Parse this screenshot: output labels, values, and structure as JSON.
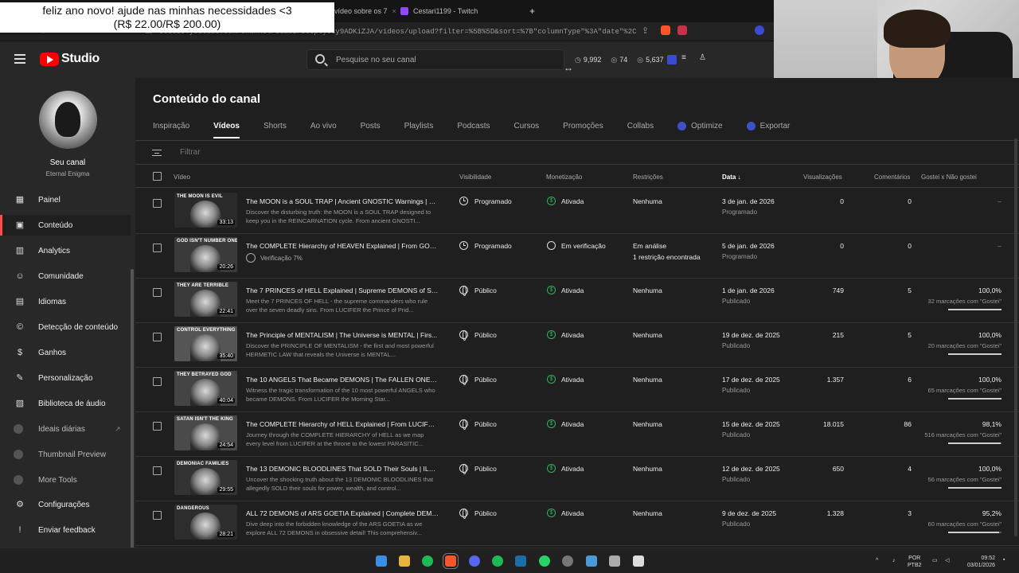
{
  "browser": {
    "tabs": [
      {
        "label": "vídeo sobre os 7"
      },
      {
        "label": "Cestari1199 - Twitch"
      }
    ],
    "new_tab": "+",
    "url": "studio.youtube.com/channel/UCzbIPJ8Cpty6sy9ADKiZJA/videos/upload?filter=%5B%5D&sort=%7B\"columnType\"%3A\"date\"%2C\"sortO..."
  },
  "overlay": {
    "line1": "feliz ano novo! ajude nas minhas necessidades <3",
    "line2": "(R$ 22.00/R$ 200.00)"
  },
  "header": {
    "logo_text": "Studio",
    "search_placeholder": "Pesquise no seu canal",
    "stats": {
      "views": "9,992",
      "likes": "74",
      "subs": "5,637"
    }
  },
  "channel": {
    "name": "Seu canal",
    "handle": "Eternal Enigma"
  },
  "sidebar": {
    "items": [
      {
        "label": "Painel",
        "icon": "dashboard-icon"
      },
      {
        "label": "Conteúdo",
        "icon": "content-icon"
      },
      {
        "label": "Analytics",
        "icon": "analytics-icon"
      },
      {
        "label": "Comunidade",
        "icon": "community-icon"
      },
      {
        "label": "Idiomas",
        "icon": "languages-icon"
      },
      {
        "label": "Detecção de conteúdo",
        "icon": "copyright-icon"
      },
      {
        "label": "Ganhos",
        "icon": "earn-icon"
      },
      {
        "label": "Personalização",
        "icon": "customization-icon"
      },
      {
        "label": "Biblioteca de áudio",
        "icon": "audio-library-icon"
      },
      {
        "label": "Ideais diárias",
        "icon": "extension-icon"
      },
      {
        "label": "Thumbnail Preview",
        "icon": "extension-icon"
      },
      {
        "label": "More Tools",
        "icon": "extension-icon"
      },
      {
        "label": "Configurações",
        "icon": "settings-icon"
      },
      {
        "label": "Enviar feedback",
        "icon": "feedback-icon"
      }
    ]
  },
  "page": {
    "title": "Conteúdo do canal",
    "tabs": [
      "Inspiração",
      "Vídeos",
      "Shorts",
      "Ao vivo",
      "Posts",
      "Playlists",
      "Podcasts",
      "Cursos",
      "Promoções",
      "Collabs",
      "Optimize",
      "Exportar"
    ],
    "filter_placeholder": "Filtrar"
  },
  "table": {
    "headers": {
      "video": "Vídeo",
      "visibility": "Visibilidade",
      "monetization": "Monetização",
      "restrictions": "Restrições",
      "date": "Data",
      "views": "Visualizações",
      "comments": "Comentários",
      "likes": "Gostei x Não gostei"
    },
    "rows": [
      {
        "thumb_text": "THE MOON IS EVIL",
        "duration": "33:13",
        "title": "The MOON is a SOUL TRAP | Ancient GNOSTIC Warnings | RE...",
        "desc": "Discover the disturbing truth: the MOON is a SOUL TRAP designed to keep you in the REINCARNATION cycle. From ancient GNOSTI...",
        "visibility": "Programado",
        "monetization": "Ativada",
        "restrictions": "Nenhuma",
        "restrictions2": "",
        "date": "3 de jan. de 2026",
        "date_status": "Programado",
        "views": "0",
        "comments": "0",
        "likes_pct": "–",
        "likes_sub": "",
        "likes_fraction": 0
      },
      {
        "thumb_text": "GOD ISN'T NUMBER ONE",
        "duration": "20:26",
        "title": "The COMPLETE Hierarchy of HEAVEN Explained | From GOD ...",
        "desc": "",
        "verification": "Verificação 7%",
        "visibility": "Programado",
        "monetization": "Em verificação",
        "restrictions": "Em análise",
        "restrictions2": "1 restrição encontrada",
        "date": "5 de jan. de 2026",
        "date_status": "Programado",
        "views": "0",
        "comments": "0",
        "likes_pct": "–",
        "likes_sub": "",
        "likes_fraction": 0
      },
      {
        "thumb_text": "THEY ARE TERRIBLE",
        "duration": "22:41",
        "title": "The 7 PRINCES of HELL Explained | Supreme DEMONS of Sin...",
        "desc": "Meet the 7 PRINCES OF HELL - the supreme commanders who rule over the seven deadly sins. From LUCIFER the Prince of Prid...",
        "visibility": "Público",
        "monetization": "Ativada",
        "restrictions": "Nenhuma",
        "restrictions2": "",
        "date": "1 de jan. de 2026",
        "date_status": "Publicado",
        "views": "749",
        "comments": "5",
        "likes_pct": "100,0%",
        "likes_sub": "32 marcações com \"Gostei\"",
        "likes_fraction": 1.0
      },
      {
        "thumb_text": "CONTROL EVERYTHING",
        "duration": "35:40",
        "title": "The Principle of MENTALISM | The Universe is MENTAL | Firs...",
        "desc": "Discover the PRINCIPLE OF MENTALISM - the first and most powerful HERMETIC LAW that reveals the Universe is MENTAL...",
        "visibility": "Público",
        "monetization": "Ativada",
        "restrictions": "Nenhuma",
        "restrictions2": "",
        "date": "19 de dez. de 2025",
        "date_status": "Publicado",
        "views": "215",
        "comments": "5",
        "likes_pct": "100,0%",
        "likes_sub": "20 marcações com \"Gostei\"",
        "likes_fraction": 1.0
      },
      {
        "thumb_text": "THEY BETRAYED GOD",
        "duration": "40:04",
        "title": "The 10 ANGELS That Became DEMONS | The FALLEN ONES ...",
        "desc": "Witness the tragic transformation of the 10 most powerful ANGELS who became DEMONS. From LUCIFER the Morning Star...",
        "visibility": "Público",
        "monetization": "Ativada",
        "restrictions": "Nenhuma",
        "restrictions2": "",
        "date": "17 de dez. de 2025",
        "date_status": "Publicado",
        "views": "1.357",
        "comments": "6",
        "likes_pct": "100,0%",
        "likes_sub": "65 marcações com \"Gostei\"",
        "likes_fraction": 1.0
      },
      {
        "thumb_text": "SATAN ISN'T THE KING",
        "duration": "24:54",
        "title": "The COMPLETE Hierarchy of HELL Explained | From LUCIFER...",
        "desc": "Journey through the COMPLETE HIERARCHY of HELL as we map every level from LUCIFER at the throne to the lowest PARASITIC...",
        "visibility": "Público",
        "monetization": "Ativada",
        "restrictions": "Nenhuma",
        "restrictions2": "",
        "date": "15 de dez. de 2025",
        "date_status": "Publicado",
        "views": "18.015",
        "comments": "86",
        "likes_pct": "98,1%",
        "likes_sub": "516 marcações com \"Gostei\"",
        "likes_fraction": 0.981
      },
      {
        "thumb_text": "DEMONIAC FAMILIES",
        "duration": "29:55",
        "title": "The 13 DEMONIC BLOODLINES That SOLD Their Souls | ILLU...",
        "desc": "Uncover the shocking truth about the 13 DEMONIC BLOODLINES that allegedly SOLD their souls for power, wealth, and control...",
        "visibility": "Público",
        "monetization": "Ativada",
        "restrictions": "Nenhuma",
        "restrictions2": "",
        "date": "12 de dez. de 2025",
        "date_status": "Publicado",
        "views": "650",
        "comments": "4",
        "likes_pct": "100,0%",
        "likes_sub": "56 marcações com \"Gostei\"",
        "likes_fraction": 1.0
      },
      {
        "thumb_text": "DANGEROUS",
        "duration": "28:21",
        "title": "ALL 72 DEMONS of ARS GOETIA Explained | Complete DEMO...",
        "desc": "Dive deep into the forbidden knowledge of the ARS GOETIA as we explore ALL 72 DEMONS in obsessive detail! This comprehensiv...",
        "visibility": "Público",
        "monetization": "Ativada",
        "restrictions": "Nenhuma",
        "restrictions2": "",
        "date": "9 de dez. de 2025",
        "date_status": "Publicado",
        "views": "1.328",
        "comments": "3",
        "likes_pct": "95,2%",
        "likes_sub": "60 marcações com \"Gostei\"",
        "likes_fraction": 0.952
      }
    ]
  },
  "taskbar": {
    "lang1": "POR",
    "lang2": "PTB2",
    "time": "09:52",
    "date": "03/01/2026"
  },
  "colors": {
    "accent_red": "#ff0000",
    "green": "#2fb35f",
    "bg": "#1f1f1f",
    "panel": "#282828"
  }
}
